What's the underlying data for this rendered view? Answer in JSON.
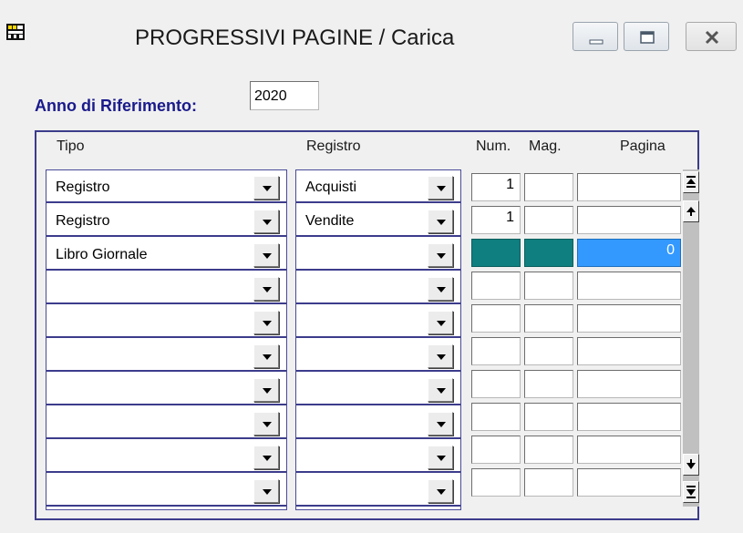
{
  "window": {
    "title": "PROGRESSIVI PAGINE / Carica"
  },
  "anno": {
    "label": "Anno di Riferimento:",
    "value": "2020"
  },
  "headers": {
    "tipo": "Tipo",
    "registro": "Registro",
    "num": "Num.",
    "mag": "Mag.",
    "pagina": "Pagina"
  },
  "rows": [
    {
      "tipo": "Registro",
      "registro": "Acquisti",
      "num": "1",
      "mag": "",
      "pagina": ""
    },
    {
      "tipo": "Registro",
      "registro": "Vendite",
      "num": "1",
      "mag": "",
      "pagina": ""
    },
    {
      "tipo": "Libro Giornale",
      "registro": "",
      "num": "",
      "mag": "",
      "pagina": "0"
    },
    {
      "tipo": "",
      "registro": "",
      "num": "",
      "mag": "",
      "pagina": ""
    },
    {
      "tipo": "",
      "registro": "",
      "num": "",
      "mag": "",
      "pagina": ""
    },
    {
      "tipo": "",
      "registro": "",
      "num": "",
      "mag": "",
      "pagina": ""
    },
    {
      "tipo": "",
      "registro": "",
      "num": "",
      "mag": "",
      "pagina": ""
    },
    {
      "tipo": "",
      "registro": "",
      "num": "",
      "mag": "",
      "pagina": ""
    },
    {
      "tipo": "",
      "registro": "",
      "num": "",
      "mag": "",
      "pagina": ""
    },
    {
      "tipo": "",
      "registro": "",
      "num": "",
      "mag": "",
      "pagina": ""
    }
  ],
  "icons": {
    "app": "app-icon",
    "minimize": "minimize-icon",
    "maximize": "maximize-icon",
    "close": "close-icon",
    "scroll_top": "scroll-top-icon",
    "scroll_up": "scroll-up-icon",
    "scroll_down": "scroll-down-icon",
    "scroll_bottom": "scroll-bottom-icon",
    "dropdown": "chevron-down-icon"
  },
  "colors": {
    "label_blue": "#1a1a8c",
    "panel_border": "#3c3c8c",
    "active_teal": "#0f7f7f",
    "selection_blue": "#3399ff"
  }
}
